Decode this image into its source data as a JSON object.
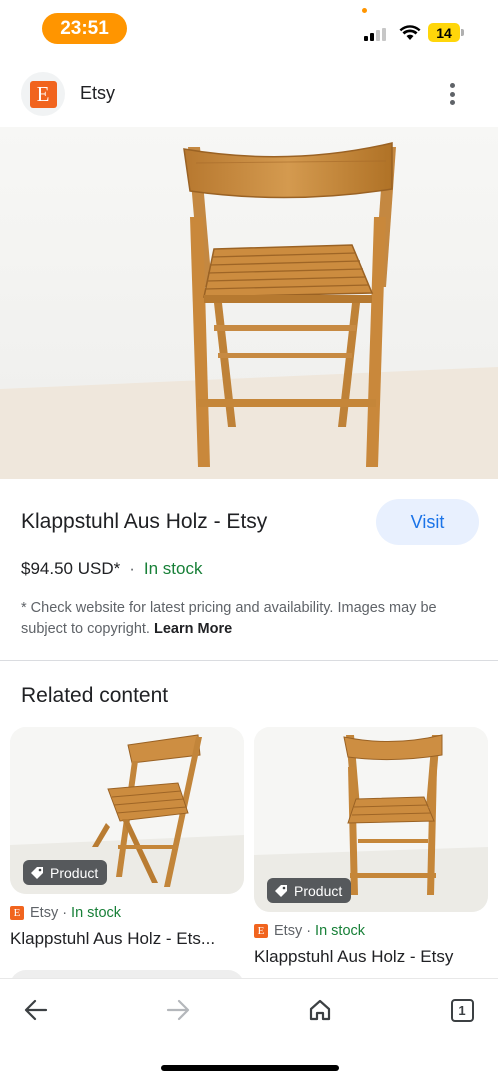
{
  "status_bar": {
    "time": "23:51",
    "battery": "14",
    "icons": [
      "signal-icon",
      "wifi-icon",
      "battery-icon"
    ]
  },
  "site": {
    "logo_letter": "E",
    "name": "Etsy",
    "menu_icon": "more-vert-icon"
  },
  "product": {
    "title": "Klappstuhl Aus Holz - Etsy",
    "visit_label": "Visit",
    "price": "$94.50 USD*",
    "separator": "·",
    "stock": "In stock",
    "disclaimer": "* Check website for latest pricing and availability. Images may be subject to copyright.",
    "learn_more": "Learn More"
  },
  "related": {
    "heading": "Related content",
    "cards": [
      {
        "badge": "Product",
        "logo_letter": "E",
        "source": "Etsy",
        "dot": "·",
        "stock": "In stock",
        "title": "Klappstuhl Aus Holz - Ets..."
      },
      {
        "badge": "Product",
        "logo_letter": "E",
        "source": "Etsy",
        "dot": "·",
        "stock": "In stock",
        "title": "Klappstuhl Aus Holz - Etsy"
      }
    ]
  },
  "bottom_nav": {
    "items": [
      "back-icon",
      "forward-icon",
      "home-icon",
      "tabs-icon"
    ],
    "tab_count": "1"
  },
  "colors": {
    "accent": "#1a73e8",
    "stock_green": "#188038",
    "etsy_orange": "#f1641e",
    "time_pill": "#ff9500"
  }
}
